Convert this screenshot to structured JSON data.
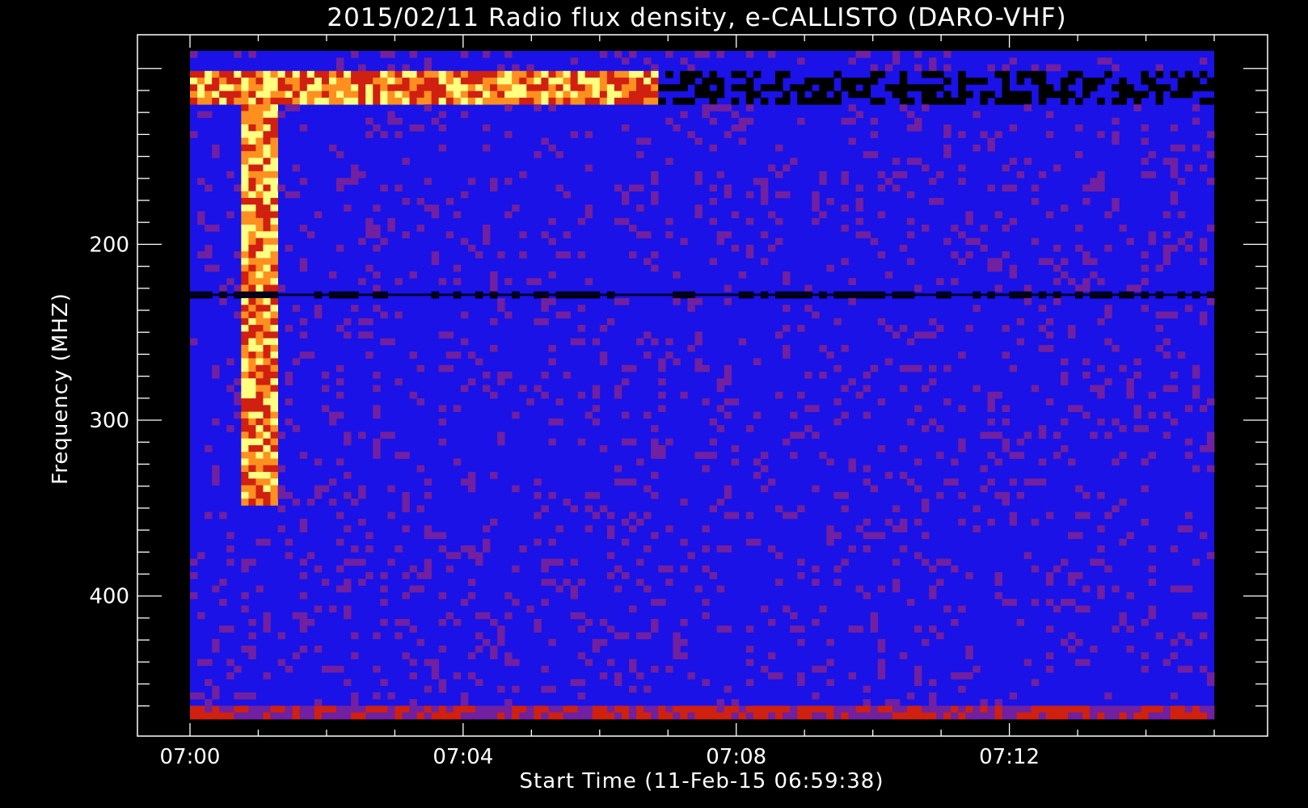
{
  "chart_data": {
    "type": "heatmap",
    "title": "2015/02/11  Radio flux density, e-CALLISTO (DARO-VHF)",
    "xlabel": "Start Time (11-Feb-15 06:59:38)",
    "ylabel": "Frequency (MHZ)",
    "x_unit": "UT time",
    "x_range": [
      "07:00",
      "07:15"
    ],
    "y_range_mhz": [
      90,
      470
    ],
    "y_inverted": true,
    "xticks": [
      {
        "t": 0,
        "label": "07:00"
      },
      {
        "t": 4,
        "label": "07:04"
      },
      {
        "t": 8,
        "label": "07:08"
      },
      {
        "t": 12,
        "label": "07:12"
      }
    ],
    "yticks": [
      {
        "v": 200,
        "label": "200"
      },
      {
        "v": 300,
        "label": "300"
      },
      {
        "v": 400,
        "label": "400"
      }
    ],
    "colormap": [
      "#000000",
      "#1010f0",
      "#7020a0",
      "#d02010",
      "#ff9020",
      "#ffff80"
    ],
    "background_level_color": "#1a12e6",
    "features": [
      {
        "kind": "intense band",
        "freq_mhz": [
          100,
          120
        ],
        "time_min": [
          0,
          6.9
        ],
        "level": "high"
      },
      {
        "kind": "dark interference",
        "freq_mhz": [
          100,
          120
        ],
        "time_min": [
          6.9,
          15
        ],
        "level": "low"
      },
      {
        "kind": "burst",
        "freq_mhz": [
          100,
          350
        ],
        "time_min": [
          0.7,
          1.3
        ],
        "level": "high"
      },
      {
        "kind": "dark line",
        "freq_mhz": [
          228,
          229
        ],
        "time_min": [
          0,
          15
        ],
        "level": "low"
      },
      {
        "kind": "noisy band",
        "freq_mhz": [
          462,
          470
        ],
        "time_min": [
          0,
          15
        ],
        "level": "medium"
      }
    ]
  }
}
